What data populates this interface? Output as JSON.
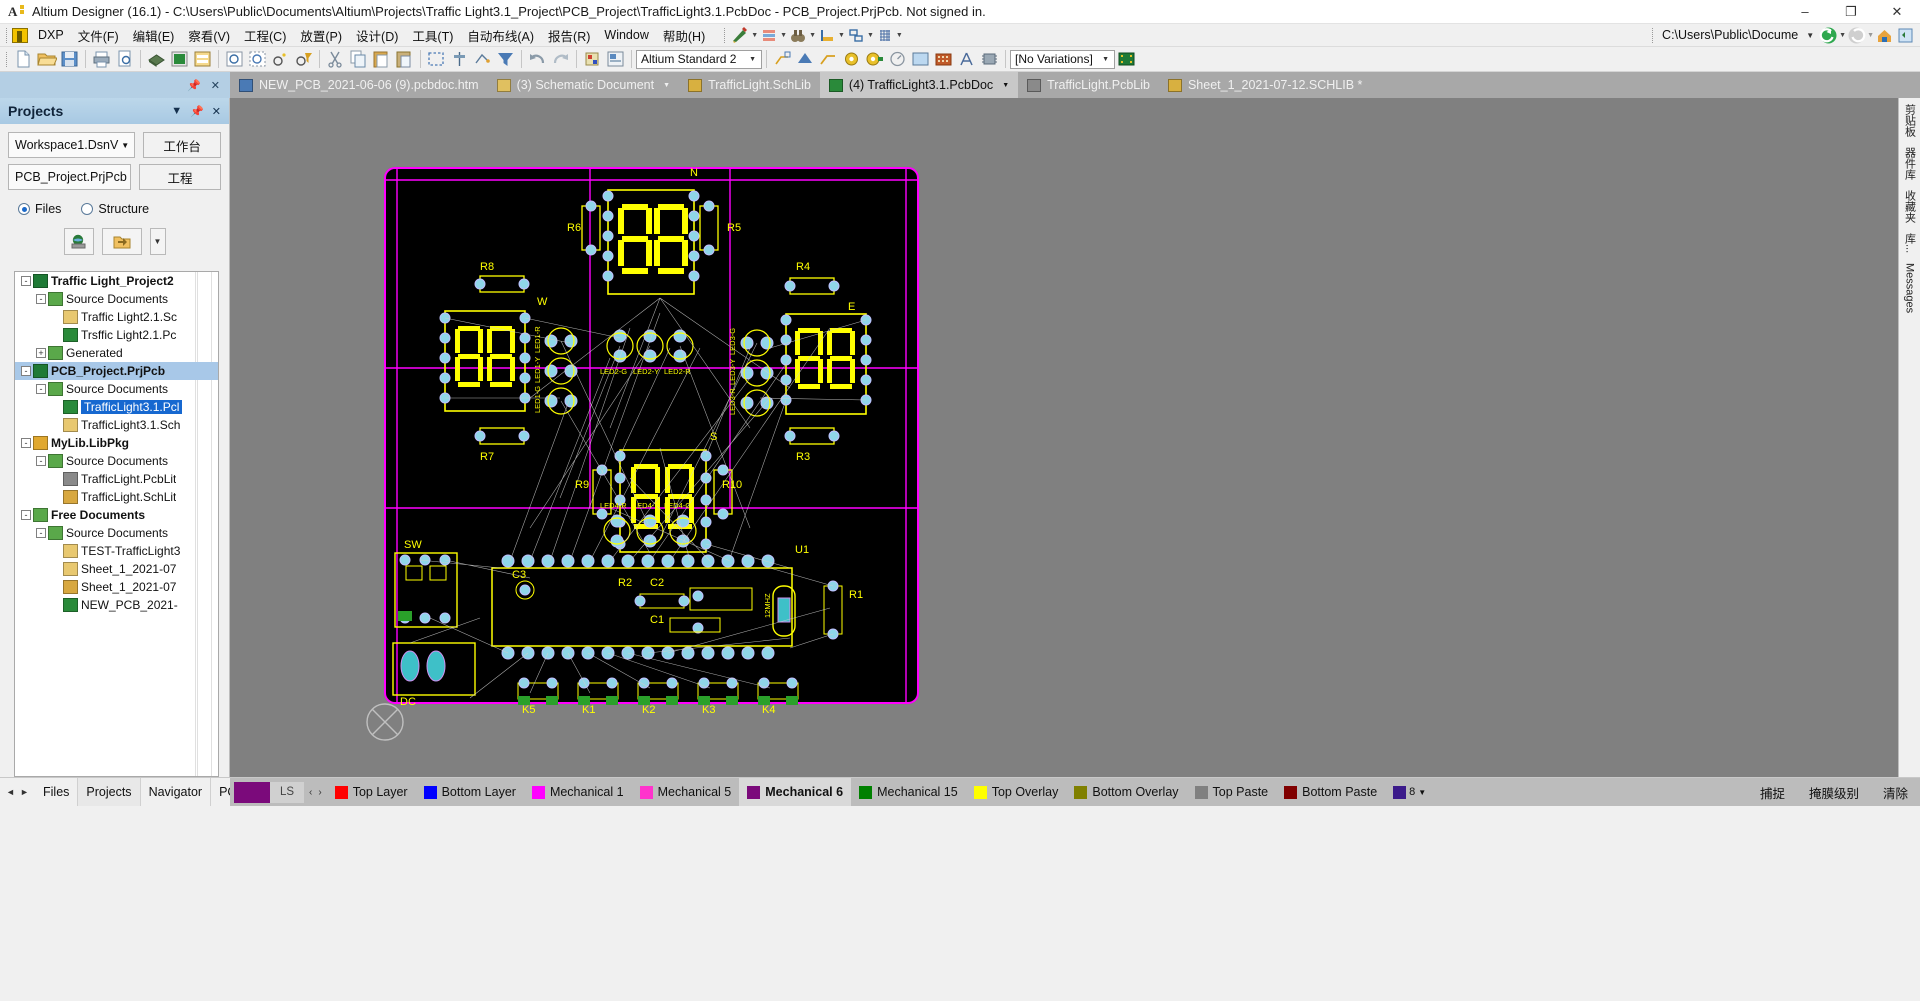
{
  "window": {
    "title": "Altium Designer (16.1) - C:\\Users\\Public\\Documents\\Altium\\Projects\\Traffic Light3.1_Project\\PCB_Project\\TrafficLight3.1.PcbDoc - PCB_Project.PrjPcb. Not signed in.",
    "app_icon": "altium-icon",
    "minimize": "–",
    "maximize": "❐",
    "close": "✕"
  },
  "menubar": {
    "dxp": "DXP",
    "items": [
      "文件(F)",
      "编辑(E)",
      "察看(V)",
      "工程(C)",
      "放置(P)",
      "设计(D)",
      "工具(T)",
      "自动布线(A)",
      "报告(R)",
      "Window",
      "帮助(H)"
    ],
    "tool_dropdowns": [
      "pencil-ruler-icon",
      "layers-icon",
      "binoculars-icon",
      "ruler-icon",
      "route-icon",
      "grid-icon"
    ],
    "path": "C:\\Users\\Public\\Docume",
    "right_icons": [
      "back-arrow-icon",
      "forward-arrow-icon",
      "home-icon",
      "refresh-icon"
    ]
  },
  "toolbar": {
    "icons_group1": [
      "new-doc-icon",
      "open-folder-icon",
      "save-icon"
    ],
    "icons_group2": [
      "print-icon",
      "print-preview-icon"
    ],
    "icons_group3": [
      "board-3d-icon",
      "pcb-doc-icon",
      "sch-doc-icon"
    ],
    "icons_group4": [
      "zoom-area-icon",
      "zoom-select-icon",
      "rotate-icon",
      "filter-rotate-icon"
    ],
    "icons_group5": [
      "cut-icon",
      "copy-icon",
      "paste-icon",
      "paste-special-icon"
    ],
    "icons_group6": [
      "select-area-icon",
      "align-icon",
      "move-icon",
      "clear-filter-icon"
    ],
    "icons_group7": [
      "undo-icon",
      "redo-icon"
    ],
    "icons_group8": [
      "cross-probe-icon",
      "browse-lib-icon"
    ],
    "standard_combo": "Altium Standard 2",
    "icons_group9": [
      "place-line-icon",
      "place-polygon-icon",
      "place-track-icon",
      "place-pad-icon",
      "place-via-icon",
      "place-arc-icon",
      "place-fill-icon",
      "place-region-icon",
      "place-string-icon",
      "place-component-icon"
    ],
    "variations_combo": "[No Variations]",
    "icons_group10": [
      "pcb-board-icon"
    ]
  },
  "tabs": [
    {
      "label": "NEW_PCB_2021-06-06 (9).pcbdoc.htm",
      "icon": "html-doc-icon",
      "active": false,
      "dropdown": false
    },
    {
      "label": "(3) Schematic Document",
      "icon": "sch-doc-icon",
      "active": false,
      "dropdown": true
    },
    {
      "label": "TrafficLight.SchLib",
      "icon": "schlib-icon",
      "active": false,
      "dropdown": false
    },
    {
      "label": "(4) TrafficLight3.1.PcbDoc",
      "icon": "pcbdoc-icon",
      "active": true,
      "dropdown": true
    },
    {
      "label": "TrafficLight.PcbLib",
      "icon": "pcblib-icon",
      "active": false,
      "dropdown": false
    },
    {
      "label": "Sheet_1_2021-07-12.SCHLIB *",
      "icon": "schlib-icon",
      "active": false,
      "dropdown": false
    }
  ],
  "projects_panel": {
    "title": "Projects",
    "header_buttons": [
      "chevron-down-icon",
      "pin-icon",
      "close-icon"
    ],
    "workspace_combo": "Workspace1.DsnV",
    "workspace_button": "工作台",
    "project_combo": "PCB_Project.PrjPcb",
    "project_button": "工程",
    "view_modes": [
      {
        "label": "Files",
        "selected": true
      },
      {
        "label": "Structure",
        "selected": false
      }
    ],
    "toolbar_buttons": [
      "globe-project-icon",
      "open-project-icon",
      "dropdown-icon"
    ],
    "tree": [
      {
        "label": "Traffic Light_Project2",
        "depth": 0,
        "icon": "pcb-project-icon",
        "bold": true,
        "expander": "-"
      },
      {
        "label": "Source Documents",
        "depth": 1,
        "icon": "folder-icon",
        "bold": false,
        "expander": "-"
      },
      {
        "label": "Traffic Light2.1.Sc",
        "depth": 2,
        "icon": "sch-file-icon",
        "bold": false,
        "expander": ""
      },
      {
        "label": "Trsffic Light2.1.Pc",
        "depth": 2,
        "icon": "pcb-file-icon",
        "bold": false,
        "expander": ""
      },
      {
        "label": "Generated",
        "depth": 1,
        "icon": "folder-icon",
        "bold": false,
        "expander": "+"
      },
      {
        "label": "PCB_Project.PrjPcb",
        "depth": 0,
        "icon": "pcb-project-icon",
        "bold": true,
        "expander": "-",
        "selected_project": true
      },
      {
        "label": "Source Documents",
        "depth": 1,
        "icon": "folder-icon",
        "bold": false,
        "expander": "-"
      },
      {
        "label": "TrafficLight3.1.Pcl",
        "depth": 2,
        "icon": "pcb-file-icon",
        "bold": false,
        "expander": "",
        "selected_file": true
      },
      {
        "label": "TrafficLight3.1.Sch",
        "depth": 2,
        "icon": "sch-file-icon",
        "bold": false,
        "expander": ""
      },
      {
        "label": "MyLib.LibPkg",
        "depth": 0,
        "icon": "libpkg-icon",
        "bold": true,
        "expander": "-"
      },
      {
        "label": "Source Documents",
        "depth": 1,
        "icon": "folder-icon",
        "bold": false,
        "expander": "-"
      },
      {
        "label": "TrafficLight.PcbLit",
        "depth": 2,
        "icon": "pcblib-file-icon",
        "bold": false,
        "expander": ""
      },
      {
        "label": "TrafficLight.SchLit",
        "depth": 2,
        "icon": "schlib-file-icon",
        "bold": false,
        "expander": ""
      },
      {
        "label": "Free Documents",
        "depth": 0,
        "icon": "folder-icon",
        "bold": true,
        "expander": "-"
      },
      {
        "label": "Source Documents",
        "depth": 1,
        "icon": "folder-icon",
        "bold": false,
        "expander": "-"
      },
      {
        "label": "TEST-TrafficLight3",
        "depth": 2,
        "icon": "sch-file-icon",
        "bold": false,
        "expander": ""
      },
      {
        "label": "Sheet_1_2021-07",
        "depth": 2,
        "icon": "sch-file-icon",
        "bold": false,
        "expander": ""
      },
      {
        "label": "Sheet_1_2021-07",
        "depth": 2,
        "icon": "schlib-file-icon",
        "bold": false,
        "expander": ""
      },
      {
        "label": "NEW_PCB_2021-",
        "depth": 2,
        "icon": "pcb-file-icon",
        "bold": false,
        "expander": ""
      }
    ]
  },
  "right_dock": [
    "剪贴板",
    "器件库",
    "收藏夹",
    "库...",
    "Messages"
  ],
  "panel_tabs": [
    {
      "label": "Files",
      "active": false
    },
    {
      "label": "Projects",
      "active": true
    },
    {
      "label": "Navigator",
      "active": false
    },
    {
      "label": "PCI",
      "active": false
    }
  ],
  "layer_tabs": {
    "ls_label": "LS",
    "ls_color": "#7b0a7b",
    "prev_arrow": "‹",
    "next_arrow": "›",
    "items": [
      {
        "label": "Top Layer",
        "color": "#ff0000",
        "active": false
      },
      {
        "label": "Bottom Layer",
        "color": "#0000ff",
        "active": false
      },
      {
        "label": "Mechanical 1",
        "color": "#ff00ff",
        "active": false
      },
      {
        "label": "Mechanical 5",
        "color": "#ff33cc",
        "active": false
      },
      {
        "label": "Mechanical 6",
        "color": "#7b0a7b",
        "active": true
      },
      {
        "label": "Mechanical 15",
        "color": "#008000",
        "active": false
      },
      {
        "label": "Top Overlay",
        "color": "#ffff00",
        "active": false
      },
      {
        "label": "Bottom Overlay",
        "color": "#808000",
        "active": false
      },
      {
        "label": "Top Paste",
        "color": "#808080",
        "active": false
      },
      {
        "label": "Bottom Paste",
        "color": "#800000",
        "active": false
      }
    ],
    "more_chip": {
      "color": "#3b1a8a",
      "label": "8"
    }
  },
  "status_right": [
    "捕捉",
    "掩膜级别",
    "清除"
  ],
  "pcb": {
    "board_outline_color": "#ff00ff",
    "background": "#000000",
    "designators": [
      "N",
      "R6",
      "R5",
      "W",
      "R8",
      "R7",
      "E",
      "R4",
      "R3",
      "S",
      "R9",
      "R10",
      "SW",
      "U1",
      "C3",
      "R2",
      "C2",
      "C1",
      "R1",
      "DC",
      "K5",
      "K1",
      "K2",
      "K3",
      "K4",
      "LED2-G",
      "LED2-Y",
      "LED2-R",
      "LED1-R",
      "LED1-Y",
      "LED1-G",
      "LED3-R",
      "LED3-Y",
      "LED3-G",
      "LED4-R",
      "LED4-Y",
      "LED4-G",
      "12MHZ"
    ]
  }
}
